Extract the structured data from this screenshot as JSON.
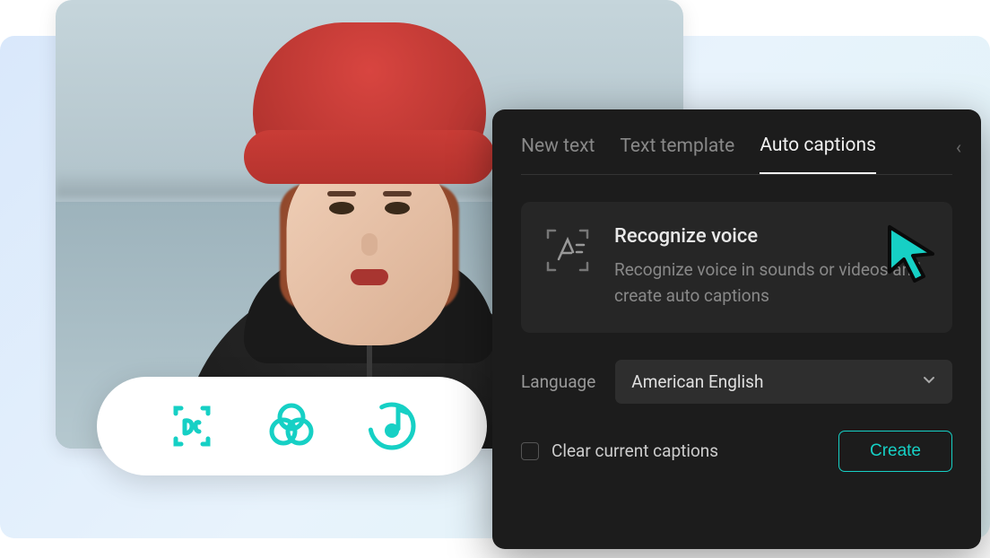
{
  "toolbar": {
    "icons": [
      "caption-icon",
      "filter-icon",
      "audio-icon"
    ]
  },
  "panel": {
    "tabs": [
      {
        "label": "New text",
        "active": false
      },
      {
        "label": "Text template",
        "active": false
      },
      {
        "label": "Auto captions",
        "active": true
      }
    ],
    "recognize": {
      "title": "Recognize voice",
      "description": "Recognize voice in sounds or videos and create auto captions"
    },
    "language": {
      "label": "Language",
      "value": "American English"
    },
    "clear_captions_label": "Clear current captions",
    "create_label": "Create"
  },
  "colors": {
    "accent": "#16d0c5"
  }
}
